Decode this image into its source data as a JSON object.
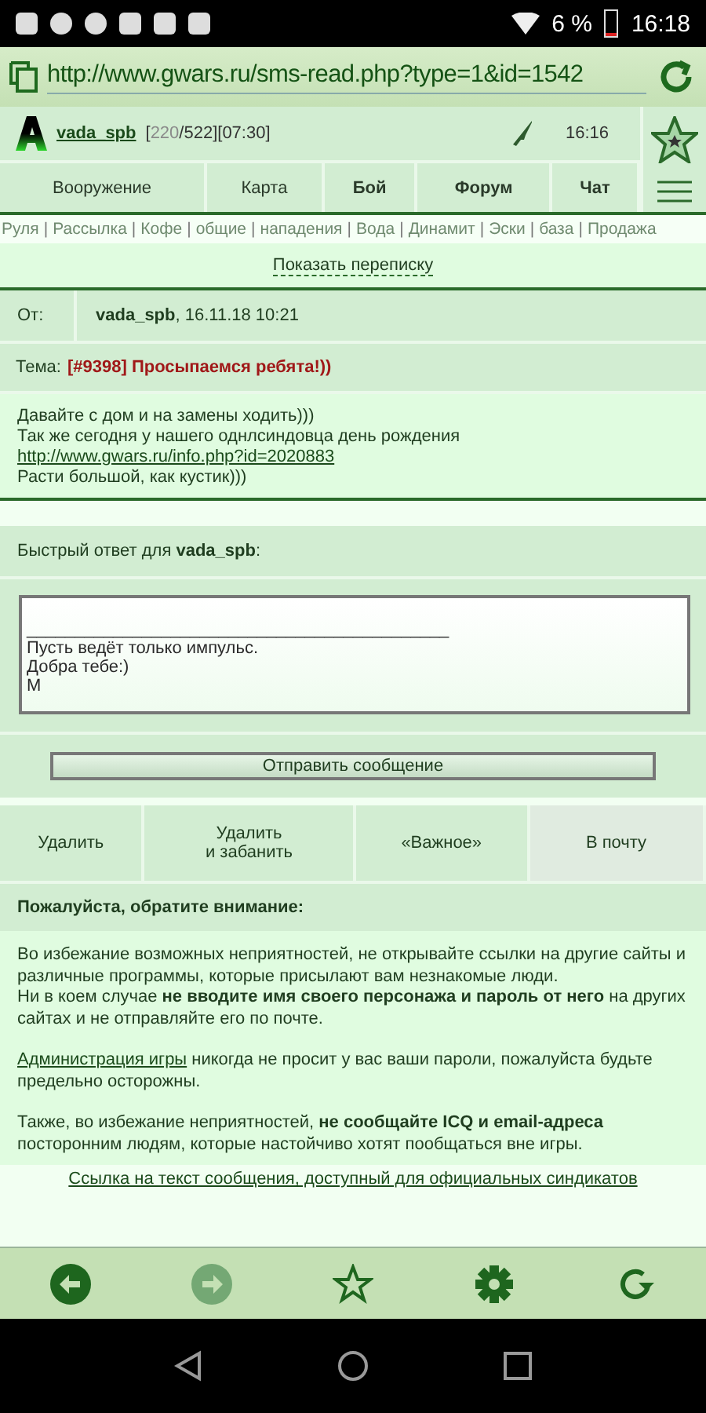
{
  "status_bar": {
    "battery": "6 %",
    "time": "16:18"
  },
  "browser": {
    "url": "http://www.gwars.ru/sms-read.php?type=1&id=1542"
  },
  "player": {
    "name": "vada_spb",
    "stats": {
      "before": "[",
      "dim": "220",
      "after": "/522][07:30]"
    },
    "time": "16:16"
  },
  "nav_tabs": [
    {
      "label": "Вооружение",
      "highlighted": false
    },
    {
      "label": "Карта",
      "highlighted": false
    },
    {
      "label": "Бой",
      "highlighted": true
    },
    {
      "label": "Форум",
      "highlighted": true
    },
    {
      "label": "Чат",
      "highlighted": true
    }
  ],
  "quick_links": {
    "separator": "|",
    "items": [
      "Руля",
      "Рассылка",
      "Кофе",
      "общие",
      "нападения",
      "Вода",
      "Динамит",
      "Эски",
      "база",
      "Продажа"
    ]
  },
  "show_thread": "Показать переписку",
  "message": {
    "from_label": "От:",
    "from_value": "**vada_spb**, 16.11.18 10:21",
    "subject_label": "Тема:",
    "subject": "[#9398] Просыпаемся ребята!))",
    "body": [
      {
        "kind": "text",
        "text": "Давайте с дом и на замены ходить)))"
      },
      {
        "kind": "text",
        "text": "Так же сегодня у нашего однлсиндовца день рождения"
      },
      {
        "kind": "link",
        "text": "http://www.gwars.ru/info.php?id=2020883"
      },
      {
        "kind": "text",
        "text": "Расти большой, как кустик)))"
      }
    ]
  },
  "reply": {
    "title": "Быстрый ответ для **vada_spb**:",
    "value": "\n____________________________________________\nПусть ведёт только импульс.\nДобра тебе:)\nМ",
    "send": "Отправить сообщение"
  },
  "actions": [
    {
      "label": "Удалить",
      "selected": false
    },
    {
      "label": "Удалить\nи забанить",
      "selected": false
    },
    {
      "label": "«Важное»",
      "selected": false
    },
    {
      "label": "В почту",
      "selected": true
    }
  ],
  "notice": {
    "title": "Пожалуйста, обратите внимание:",
    "paragraphs": [
      [
        {
          "kind": "text",
          "text": "Во избежание возможных неприятностей, не открывайте ссылки на другие сайты и различные программы, которые присылают вам незнакомые люди.\nНи в коем случае **не вводите имя своего персонажа и пароль от него** на других сайтах и не отправляйте его по почте."
        }
      ],
      [
        {
          "kind": "link",
          "text": "Администрация игры"
        },
        {
          "kind": "text",
          "text": " никогда не просит у вас ваши пароли, пожалуйста будьте предельно осторожны."
        }
      ],
      [
        {
          "kind": "text",
          "text": "Также, во избежание неприятностей, **не сообщайте ICQ и email-адреса** посторонним людям, которые настойчиво хотят пообщаться вне игры."
        }
      ]
    ]
  },
  "footer_link": "Ссылка на текст сообщения, доступный для официальных синдикатов",
  "toolbar": [
    {
      "kind": "back",
      "disabled": false
    },
    {
      "kind": "forward",
      "disabled": true
    },
    {
      "kind": "star",
      "disabled": false
    },
    {
      "kind": "settings",
      "disabled": false
    },
    {
      "kind": "reload",
      "disabled": false
    }
  ]
}
